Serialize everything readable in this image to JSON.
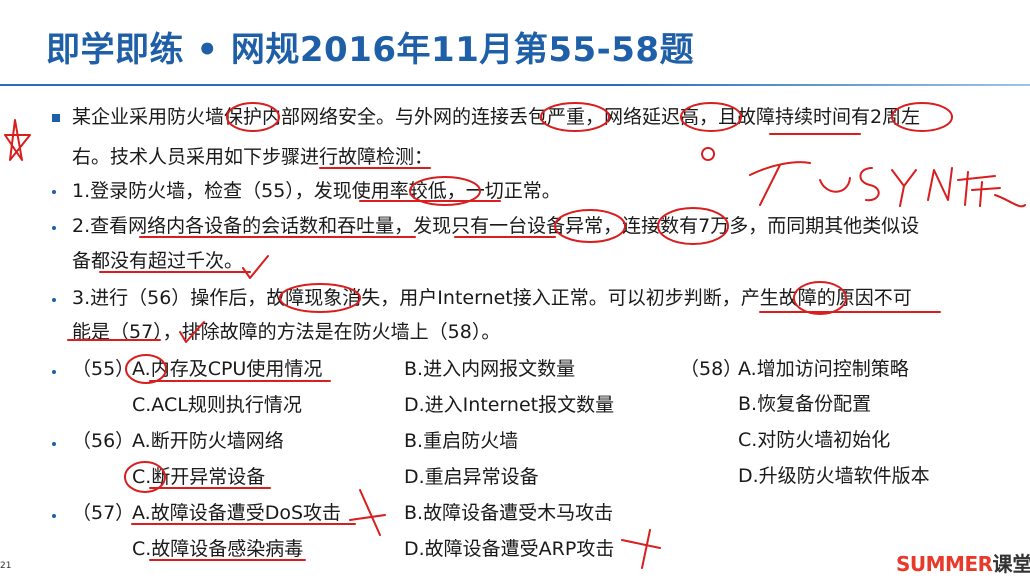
{
  "title": "即学即练 • 网规2016年11月第55-58题",
  "intro": {
    "line1": "某企业采用防火墙保护内部网络安全。与外网的连接丢包严重，网络延迟高，且故障持续时间有2周左",
    "line2": "右。技术人员采用如下步骤进行故障检测："
  },
  "steps": [
    {
      "line1": "1.登录防火墙，检查（55），发现使用率较低，一切正常。"
    },
    {
      "line1": "2.查看网络内各设备的会话数和吞吐量，发现只有一台设备异常，连接数有7万多，而同期其他类似设",
      "line2": "备都没有超过千次。"
    },
    {
      "line1": "3.进行（56）操作后，故障现象消失，用户Internet接入正常。可以初步判断，产生故障的原因不可",
      "line2": "能是（57），排除故障的方法是在防火墙上（58）。"
    }
  ],
  "q55": {
    "num": "（55）",
    "a": "A.内存及CPU使用情况",
    "b": "B.进入内网报文数量",
    "c": "C.ACL规则执行情况",
    "d": "D.进入Internet报文数量"
  },
  "q56": {
    "num": "（56）",
    "a": "A.断开防火墙网络",
    "b": "B.重启防火墙",
    "c": "C.断开异常设备",
    "d": "D.重启异常设备"
  },
  "q57": {
    "num": "（57）",
    "a": "A.故障设备遭受DoS攻击",
    "b": "B.故障设备遭受木马攻击",
    "c": "C.故障设备感染病毒",
    "d": "D.故障设备遭受ARP攻击"
  },
  "q58": {
    "num": "（58）",
    "a": "A.增加访问控制策略",
    "b": "B.恢复备份配置",
    "c": "C.对防火墙初始化",
    "d": "D.升级防火墙软件版本"
  },
  "handwriting": {
    "note": "TCP SYN flood"
  },
  "page_number": "21",
  "brand": {
    "part1": "SUMMER",
    "part2": "课堂"
  },
  "colors": {
    "title": "#1f5fa8",
    "annotation": "#d81e1e",
    "brand": "#e8392b"
  }
}
